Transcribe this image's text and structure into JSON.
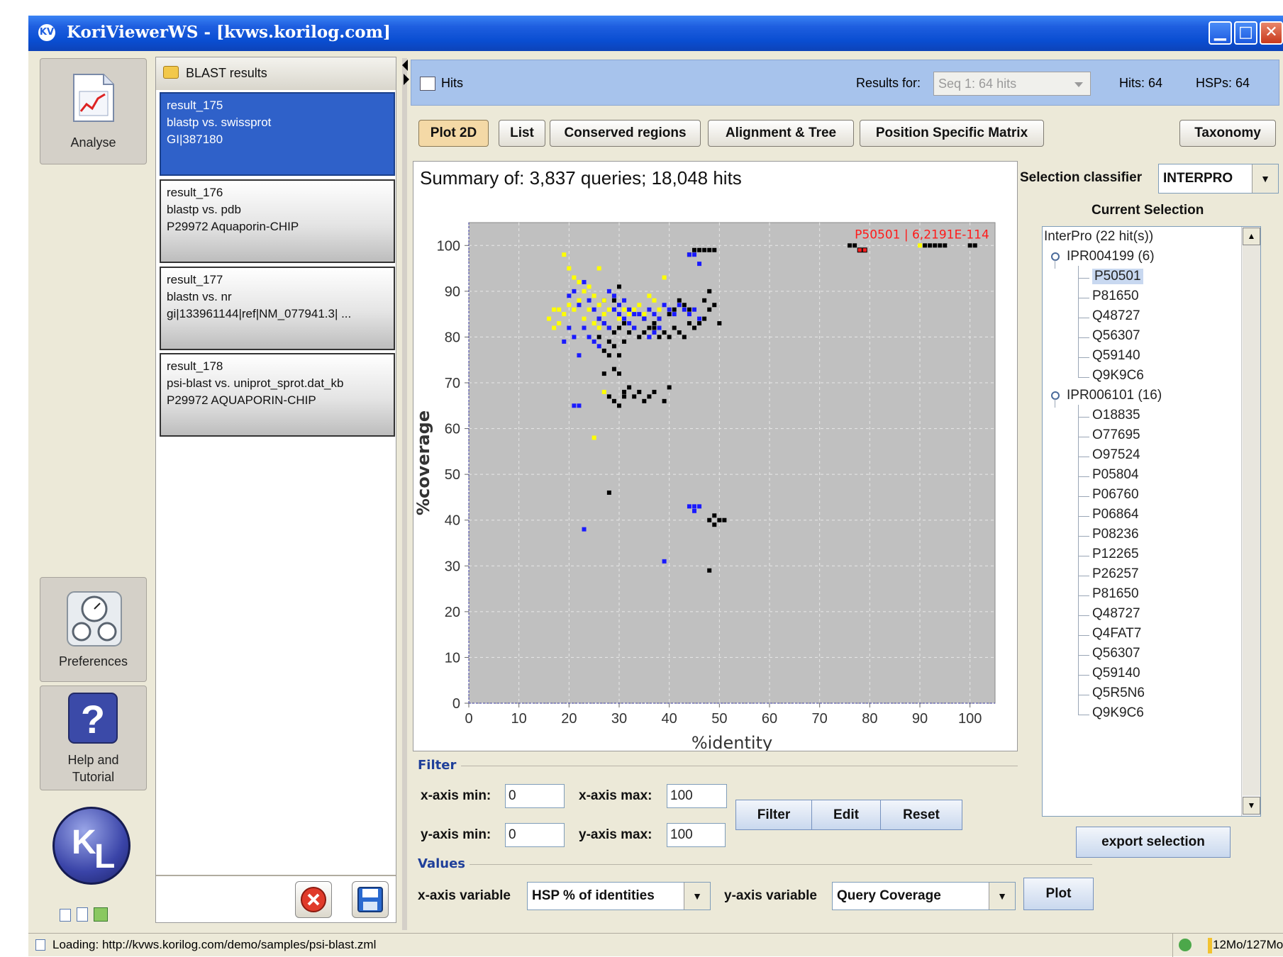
{
  "window": {
    "title": "KoriViewerWS - [kvws.korilog.com]",
    "app_icon_glyph": "KV",
    "minimize_glyph": "▁",
    "maximize_glyph": "□",
    "close_glyph": "✕"
  },
  "nav": {
    "analyse_label": "Analyse",
    "preferences_label": "Preferences",
    "help_label_line1": "Help and",
    "help_label_line2": "Tutorial",
    "logo_k": "K",
    "logo_l": "L"
  },
  "blast_list": {
    "header": "BLAST results",
    "items": [
      {
        "name": "result_175",
        "program": "blastp vs. swissprot",
        "query": "GI|387180"
      },
      {
        "name": "result_176",
        "program": "blastp vs. pdb",
        "query": "P29972 Aquaporin-CHIP"
      },
      {
        "name": "result_177",
        "program": "blastn vs. nr",
        "query": "gi|133961144|ref|NM_077941.3| ..."
      },
      {
        "name": "result_178",
        "program": "psi-blast vs. uniprot_sprot.dat_kb",
        "query": "P29972 AQUAPORIN-CHIP"
      }
    ]
  },
  "hits_bar": {
    "title": "Hits",
    "results_for_label": "Results for:",
    "results_for_value": "Seq 1: 64 hits",
    "hits": "Hits: 64",
    "hsps": "HSPs: 64"
  },
  "tabs": {
    "plot2d": "Plot 2D",
    "list": "List",
    "conserved": "Conserved regions",
    "alignment": "Alignment & Tree",
    "pssm": "Position Specific Matrix",
    "taxonomy": "Taxonomy"
  },
  "plot": {
    "summary": "Summary of: 3,837 queries; 18,048 hits",
    "annotation": "P50501 | 6,2191E-114"
  },
  "chart_data": {
    "type": "scatter",
    "title": "Summary of: 3,837 queries; 18,048 hits",
    "xlabel": "%identity",
    "ylabel": "%coverage",
    "xlim": [
      0,
      105
    ],
    "ylim": [
      0,
      105
    ],
    "xticks": [
      "0",
      "10",
      "20",
      "30",
      "40",
      "50",
      "60",
      "70",
      "80",
      "90",
      "100"
    ],
    "yticks": [
      "0",
      "10",
      "20",
      "30",
      "40",
      "50",
      "60",
      "70",
      "80",
      "90",
      "100"
    ],
    "grid": true,
    "background": "#c0c0c0",
    "series": [
      {
        "color": "#000000",
        "points": [
          [
            26,
            84
          ],
          [
            27,
            83
          ],
          [
            28,
            82
          ],
          [
            29,
            81
          ],
          [
            30,
            82
          ],
          [
            31,
            83
          ],
          [
            32,
            81
          ],
          [
            33,
            82
          ],
          [
            34,
            80
          ],
          [
            35,
            81
          ],
          [
            36,
            80
          ],
          [
            37,
            82
          ],
          [
            38,
            80
          ],
          [
            39,
            81
          ],
          [
            40,
            80
          ],
          [
            41,
            82
          ],
          [
            42,
            81
          ],
          [
            43,
            80
          ],
          [
            44,
            83
          ],
          [
            45,
            82
          ],
          [
            46,
            83
          ],
          [
            47,
            84
          ],
          [
            48,
            86
          ],
          [
            49,
            87
          ],
          [
            47,
            88
          ],
          [
            48,
            90
          ],
          [
            44,
            86
          ],
          [
            43,
            87
          ],
          [
            42,
            88
          ],
          [
            41,
            86
          ],
          [
            40,
            85
          ],
          [
            29,
            88
          ],
          [
            30,
            91
          ],
          [
            27,
            77
          ],
          [
            28,
            76
          ],
          [
            29,
            73
          ],
          [
            30,
            72
          ],
          [
            31,
            68
          ],
          [
            32,
            69
          ],
          [
            33,
            67
          ],
          [
            34,
            68
          ],
          [
            35,
            66
          ],
          [
            36,
            67
          ],
          [
            37,
            68
          ],
          [
            28,
            67
          ],
          [
            29,
            66
          ],
          [
            30,
            65
          ],
          [
            31,
            67
          ],
          [
            39,
            66
          ],
          [
            40,
            69
          ],
          [
            27,
            72
          ],
          [
            26,
            80
          ],
          [
            28,
            79
          ],
          [
            29,
            78
          ],
          [
            30,
            76
          ],
          [
            31,
            79
          ],
          [
            45,
            99
          ],
          [
            46,
            99
          ],
          [
            47,
            99
          ],
          [
            48,
            99
          ],
          [
            44,
            98
          ],
          [
            49,
            99
          ],
          [
            50,
            83
          ],
          [
            28,
            46
          ],
          [
            48,
            40
          ],
          [
            49,
            41
          ],
          [
            49,
            39
          ],
          [
            50,
            40
          ],
          [
            51,
            40
          ],
          [
            48,
            29
          ],
          [
            77,
            100
          ],
          [
            76,
            100
          ],
          [
            91,
            100
          ],
          [
            92,
            100
          ],
          [
            93,
            100
          ],
          [
            94,
            100
          ],
          [
            95,
            100
          ],
          [
            100,
            100
          ],
          [
            101,
            100
          ],
          [
            35,
            84
          ],
          [
            36,
            82
          ],
          [
            37,
            83
          ],
          [
            38,
            84
          ]
        ]
      },
      {
        "color": "#1a1aff",
        "points": [
          [
            20,
            89
          ],
          [
            21,
            90
          ],
          [
            22,
            87
          ],
          [
            23,
            92
          ],
          [
            24,
            88
          ],
          [
            25,
            86
          ],
          [
            26,
            84
          ],
          [
            27,
            83
          ],
          [
            28,
            82
          ],
          [
            29,
            86
          ],
          [
            30,
            85
          ],
          [
            31,
            84
          ],
          [
            32,
            83
          ],
          [
            33,
            82
          ],
          [
            34,
            85
          ],
          [
            35,
            84
          ],
          [
            36,
            86
          ],
          [
            37,
            85
          ],
          [
            38,
            84
          ],
          [
            39,
            87
          ],
          [
            40,
            86
          ],
          [
            41,
            85
          ],
          [
            42,
            87
          ],
          [
            43,
            86
          ],
          [
            44,
            85
          ],
          [
            45,
            86
          ],
          [
            46,
            84
          ],
          [
            24,
            80
          ],
          [
            25,
            79
          ],
          [
            26,
            78
          ],
          [
            22,
            76
          ],
          [
            23,
            82
          ],
          [
            21,
            80
          ],
          [
            19,
            79
          ],
          [
            20,
            82
          ],
          [
            44,
            98
          ],
          [
            45,
            98
          ],
          [
            46,
            96
          ],
          [
            21,
            65
          ],
          [
            22,
            65
          ],
          [
            23,
            38
          ],
          [
            39,
            31
          ],
          [
            44,
            43
          ],
          [
            45,
            43
          ],
          [
            46,
            43
          ],
          [
            45,
            42
          ],
          [
            27,
            88
          ],
          [
            28,
            90
          ],
          [
            29,
            89
          ],
          [
            30,
            87
          ],
          [
            31,
            88
          ],
          [
            32,
            86
          ],
          [
            33,
            85
          ],
          [
            37,
            81
          ],
          [
            38,
            82
          ],
          [
            36,
            80
          ]
        ]
      },
      {
        "color": "#ffff00",
        "points": [
          [
            19,
            98
          ],
          [
            20,
            95
          ],
          [
            21,
            93
          ],
          [
            22,
            92
          ],
          [
            23,
            90
          ],
          [
            24,
            91
          ],
          [
            25,
            89
          ],
          [
            26,
            87
          ],
          [
            27,
            88
          ],
          [
            28,
            86
          ],
          [
            17,
            86
          ],
          [
            18,
            86
          ],
          [
            16,
            84
          ],
          [
            17,
            82
          ],
          [
            18,
            83
          ],
          [
            19,
            85
          ],
          [
            20,
            87
          ],
          [
            21,
            86
          ],
          [
            22,
            88
          ],
          [
            23,
            84
          ],
          [
            24,
            86
          ],
          [
            25,
            83
          ],
          [
            26,
            82
          ],
          [
            27,
            85
          ],
          [
            33,
            86
          ],
          [
            34,
            87
          ],
          [
            35,
            85
          ],
          [
            36,
            89
          ],
          [
            37,
            88
          ],
          [
            38,
            86
          ],
          [
            39,
            93
          ],
          [
            25,
            58
          ],
          [
            27,
            68
          ],
          [
            26,
            95
          ],
          [
            90,
            100
          ],
          [
            30,
            84
          ],
          [
            31,
            86
          ],
          [
            32,
            85
          ]
        ]
      },
      {
        "color": "#ff2020",
        "points": [
          [
            78,
            99
          ],
          [
            79,
            99
          ]
        ]
      }
    ]
  },
  "filter": {
    "section": "Filter",
    "xmin_label": "x-axis min:",
    "xmin": "0",
    "xmax_label": "x-axis max:",
    "xmax": "100",
    "ymin_label": "y-axis min:",
    "ymin": "0",
    "ymax_label": "y-axis max:",
    "ymax": "100",
    "filter_btn": "Filter",
    "edit_btn": "Edit",
    "reset_btn": "Reset"
  },
  "values": {
    "section": "Values",
    "x_label": "x-axis variable",
    "x_value": "HSP % of identities",
    "y_label": "y-axis variable",
    "y_value": "Query Coverage",
    "plot_btn": "Plot"
  },
  "right": {
    "classifier_label": "Selection classifier",
    "classifier_value": "INTERPRO",
    "current_selection": "Current Selection",
    "export_btn": "export selection",
    "tree_root": "InterPro (22 hit(s))",
    "groups": [
      {
        "label": "IPR004199 (6)",
        "items": [
          "P50501",
          "P81650",
          "Q48727",
          "Q56307",
          "Q59140",
          "Q9K9C6"
        ]
      },
      {
        "label": "IPR006101 (16)",
        "items": [
          "O18835",
          "O77695",
          "O97524",
          "P05804",
          "P06760",
          "P06864",
          "P08236",
          "P12265",
          "P26257",
          "P81650",
          "Q48727",
          "Q4FAT7",
          "Q56307",
          "Q59140",
          "Q5R5N6",
          "Q9K9C6"
        ]
      }
    ]
  },
  "status": {
    "text": "Loading: http://kvws.korilog.com/demo/samples/psi-blast.zml",
    "memory": "12Mo/127Mo"
  }
}
